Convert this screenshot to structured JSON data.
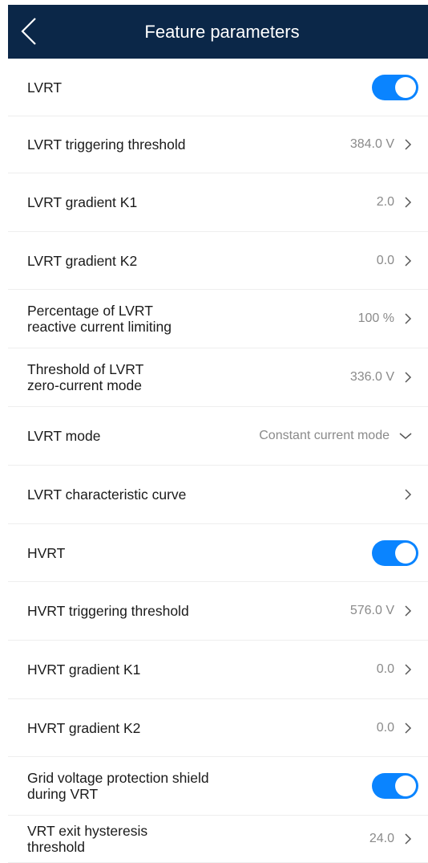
{
  "header": {
    "title": "Feature parameters"
  },
  "rows": [
    {
      "label": "LVRT",
      "kind": "toggle",
      "on": true
    },
    {
      "label": "LVRT triggering threshold",
      "value": "384.0 V",
      "kind": "chevron"
    },
    {
      "label": "LVRT gradient K1",
      "value": "2.0",
      "kind": "chevron"
    },
    {
      "label": "LVRT gradient K2",
      "value": "0.0",
      "kind": "chevron"
    },
    {
      "label": "Percentage of LVRT\nreactive current limiting",
      "value": "100 %",
      "kind": "chevron"
    },
    {
      "label": "Threshold of LVRT\nzero-current mode",
      "value": "336.0 V",
      "kind": "chevron"
    },
    {
      "label": "LVRT mode",
      "value": "Constant current mode",
      "kind": "dropdown"
    },
    {
      "label": "LVRT characteristic curve",
      "kind": "chevron"
    },
    {
      "label": "HVRT",
      "kind": "toggle",
      "on": true
    },
    {
      "label": "HVRT triggering threshold",
      "value": "576.0 V",
      "kind": "chevron"
    },
    {
      "label": "HVRT gradient K1",
      "value": "0.0",
      "kind": "chevron"
    },
    {
      "label": "HVRT gradient K2",
      "value": "0.0",
      "kind": "chevron"
    },
    {
      "label": "Grid voltage protection shield\nduring VRT",
      "kind": "toggle",
      "on": true
    },
    {
      "label": "VRT exit hysteresis\nthreshold",
      "value": "24.0",
      "kind": "chevron"
    }
  ],
  "colors": {
    "header_bg": "#0b2748",
    "toggle_on": "#0a84ff"
  }
}
